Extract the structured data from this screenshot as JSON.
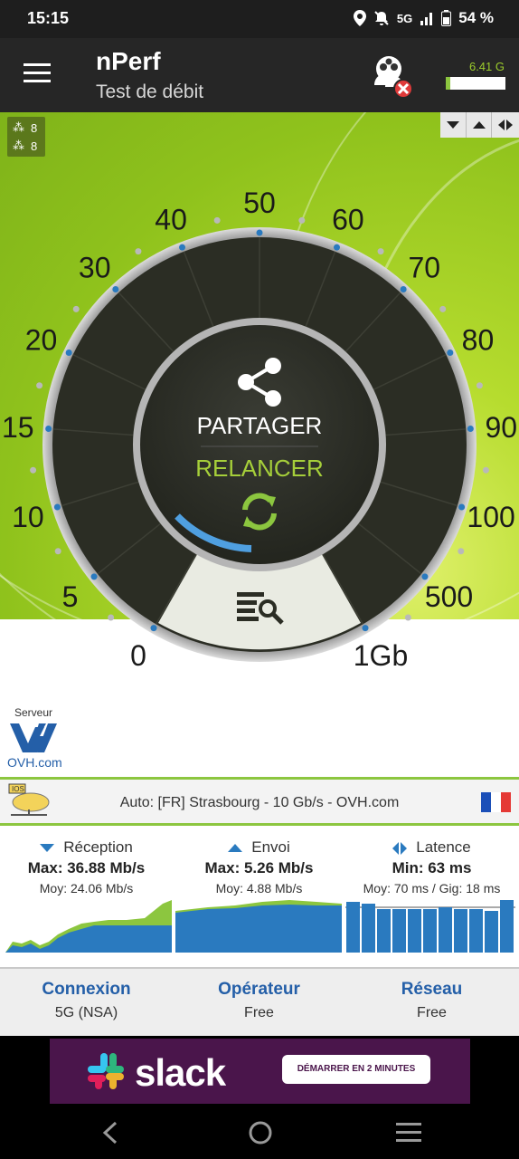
{
  "status_bar": {
    "time": "15:15",
    "network": "5G",
    "battery": "54 %"
  },
  "app_bar": {
    "title": "nPerf",
    "subtitle": "Test de débit",
    "data_usage": "6.41 G",
    "usage_fill": 0.08
  },
  "gauge": {
    "scale_labels": [
      "0",
      "5",
      "10",
      "15",
      "20",
      "30",
      "40",
      "50",
      "60",
      "70",
      "80",
      "90",
      "100",
      "500",
      "1Gb"
    ],
    "share_label": "PARTAGER",
    "restart_label": "RELANCER",
    "counter_top": "8",
    "counter_bottom": "8",
    "controls": [
      "arrow-down",
      "arrow-up",
      "arrows-left-right"
    ]
  },
  "server": {
    "label": "Serveur",
    "logo_text": "OVH.com",
    "ios_badge": "IOS",
    "description": "Auto: [FR] Strasbourg - 10 Gb/s - OVH.com"
  },
  "results": {
    "download": {
      "header": "Réception",
      "max": "Max: 36.88 Mb/s",
      "avg": "Moy: 24.06 Mb/s"
    },
    "upload": {
      "header": "Envoi",
      "max": "Max: 5.26 Mb/s",
      "avg": "Moy: 4.88 Mb/s"
    },
    "latency": {
      "header": "Latence",
      "min": "Min: 63 ms",
      "avg": "Moy: 70 ms / Gig: 18 ms"
    }
  },
  "connection": {
    "connexion_label": "Connexion",
    "connexion_value": "5G (NSA)",
    "operator_label": "Opérateur",
    "operator_value": "Free",
    "network_label": "Réseau",
    "network_value": "Free"
  },
  "ad": {
    "brand": "slack",
    "cta": "DÉMARRER EN 2 MINUTES"
  },
  "colors": {
    "accent_green": "#8cc63f",
    "blue": "#245fa8",
    "chart_blue": "#2a7abf",
    "gauge_dark": "#2b2d24"
  }
}
